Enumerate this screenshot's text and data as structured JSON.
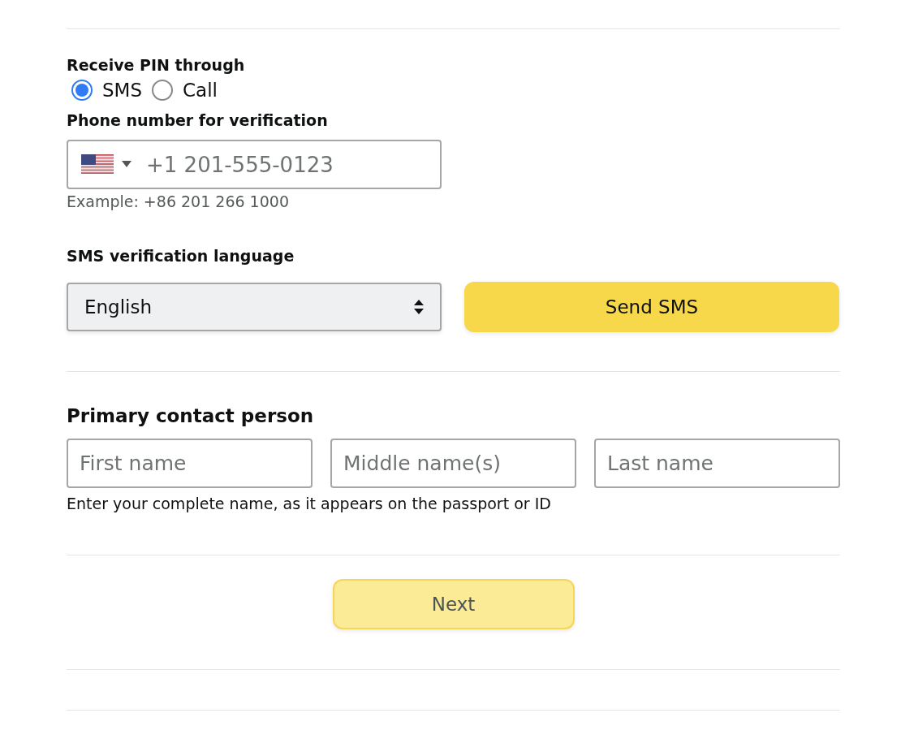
{
  "pin_method": {
    "label": "Receive PIN through",
    "options": [
      {
        "label": "SMS",
        "selected": true
      },
      {
        "label": "Call",
        "selected": false
      }
    ]
  },
  "phone": {
    "label": "Phone number for verification",
    "placeholder": "+1 201-555-0123",
    "hint": "Example: +86 201 266 1000"
  },
  "language": {
    "label": "SMS verification language",
    "value": "English"
  },
  "send_button": {
    "label": "Send SMS",
    "disabled": false
  },
  "contact": {
    "title": "Primary contact person",
    "fields": [
      {
        "placeholder": "First name"
      },
      {
        "placeholder": "Middle name(s)"
      },
      {
        "placeholder": "Last name"
      }
    ],
    "hint": "Enter your complete name, as it appears on the passport or ID"
  },
  "next_button": {
    "label": "Next",
    "disabled": true
  }
}
